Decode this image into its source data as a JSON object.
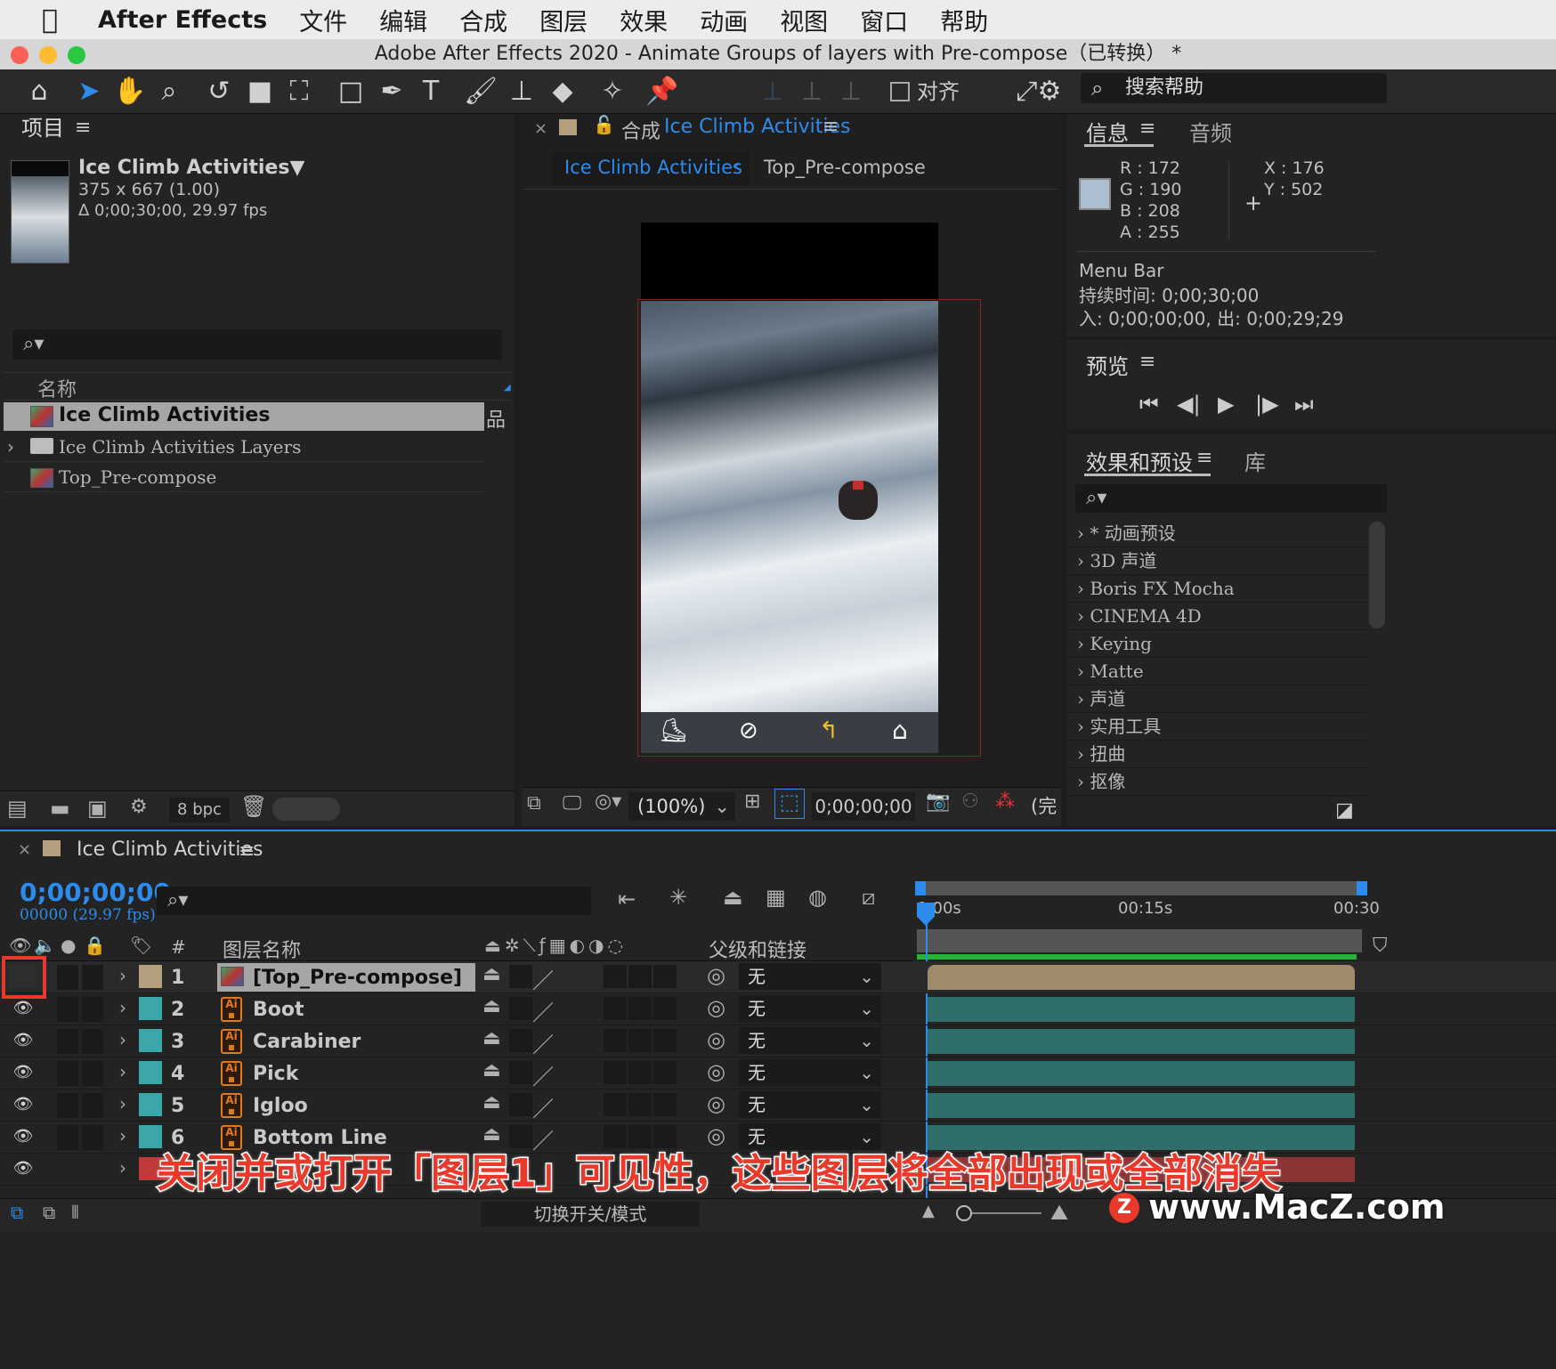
{
  "menubar": {
    "app_name": "After Effects",
    "items": [
      "文件",
      "编辑",
      "合成",
      "图层",
      "效果",
      "动画",
      "视图",
      "窗口",
      "帮助"
    ]
  },
  "window": {
    "title": "Adobe After Effects 2020 - Animate Groups of layers with Pre-compose（已转换） *"
  },
  "toolbar": {
    "snap_label": "对齐",
    "search_help_placeholder": "搜索帮助"
  },
  "project": {
    "title": "项目",
    "comp_name": "Ice Climb Activities▼",
    "comp_size": "375 x 667 (1.00)",
    "comp_duration": "Δ 0;00;30;00, 29.97 fps",
    "column_name": "名称",
    "items": [
      "Ice Climb Activities",
      "Ice Climb Activities Layers",
      "Top_Pre-compose"
    ],
    "bpc": "8 bpc"
  },
  "composition": {
    "tab_prefix": "合成",
    "tab_name": "Ice Climb Activities",
    "breadcrumb_active": "Ice Climb Activities",
    "breadcrumb_next": "Top_Pre-compose",
    "zoom": "(100%)",
    "timecode": "0;00;00;00",
    "resolution": "(完"
  },
  "info": {
    "tab_info": "信息",
    "tab_audio": "音频",
    "r": "R :  172",
    "g": "G :  190",
    "b": "B :  208",
    "a": "A :  255",
    "x": "X : 176",
    "y": "Y :  502",
    "swatch_color": "#acbed0",
    "layer_name": "Menu Bar",
    "duration": "持续时间: 0;00;30;00",
    "inout": "入: 0;00;00;00,  出: 0;00;29;29"
  },
  "preview": {
    "title": "预览"
  },
  "effects": {
    "tab_effects": "效果和预设",
    "tab_library": "库",
    "items": [
      "* 动画预设",
      "3D 声道",
      "Boris FX Mocha",
      "CINEMA 4D",
      "Keying",
      "Matte",
      "声道",
      "实用工具",
      "扭曲",
      "抠像"
    ]
  },
  "timeline": {
    "tab_name": "Ice Climb Activities",
    "timecode": "0;00;00;00",
    "frame_info": "00000 (29.97 fps)",
    "col_hash": "#",
    "col_layer_name": "图层名称",
    "col_parent": "父级和链接",
    "ruler": [
      "0:00s",
      "00:15s",
      "00:30"
    ],
    "layers": [
      {
        "num": "1",
        "name": "[Top_Pre-compose]",
        "parent": "无",
        "color": "#b4a07e"
      },
      {
        "num": "2",
        "name": "Boot",
        "parent": "无",
        "color": "#3ca7a8"
      },
      {
        "num": "3",
        "name": "Carabiner",
        "parent": "无",
        "color": "#3ca7a8"
      },
      {
        "num": "4",
        "name": "Pick",
        "parent": "无",
        "color": "#3ca7a8"
      },
      {
        "num": "5",
        "name": "Igloo",
        "parent": "无",
        "color": "#3ca7a8"
      },
      {
        "num": "6",
        "name": "Bottom Line",
        "parent": "无",
        "color": "#3ca7a8"
      }
    ],
    "toggle_mode": "切换开关/模式"
  },
  "overlay": {
    "caption": "关闭并或打开「图层1」可见性，这些图层将全部出现或全部消失",
    "watermark": "www.MacZ.com",
    "watermark_logo": "Z"
  },
  "colors": {
    "accent_blue": "#2d8ceb",
    "highlight_red": "#e8392b",
    "teal_bar": "#2f6e6a",
    "tan_bar": "#9f8b6a"
  }
}
